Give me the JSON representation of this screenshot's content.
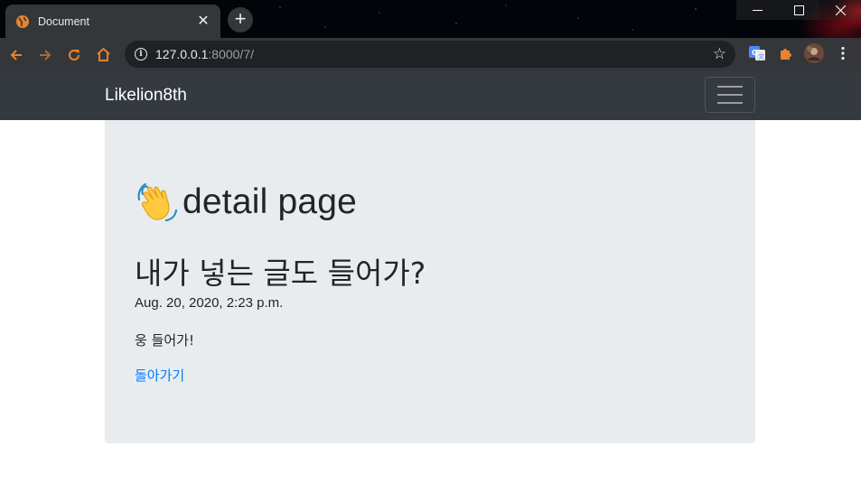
{
  "browser": {
    "tab_title": "Document",
    "new_tab_symbol": "+",
    "url_host": "127.0.0.1",
    "url_path": ":8000/7/",
    "tab_close_symbol": "✕",
    "icons": {
      "tab_favicon": "globe-icon",
      "back": "arrow-left-icon",
      "forward": "arrow-right-icon",
      "reload": "reload-icon",
      "home": "home-icon",
      "site_info": "info-icon",
      "bookmark": "star-icon",
      "translate": "translate-icon",
      "extensions": "puzzle-icon",
      "profile": "avatar",
      "menu": "kebab-menu-icon"
    },
    "accent_color": "#e8832e"
  },
  "navbar": {
    "brand": "Likelion8th",
    "background": "#343a40"
  },
  "main": {
    "heading": "detail page",
    "heading_icon": "waving-hand-icon",
    "post_title": "내가 넣는 글도 들어가?",
    "post_date": "Aug. 20, 2020, 2:23 p.m.",
    "post_body": "웅 들어가!",
    "back_link": "돌아가기",
    "link_color": "#007bff",
    "panel_color": "#e9ecef"
  }
}
